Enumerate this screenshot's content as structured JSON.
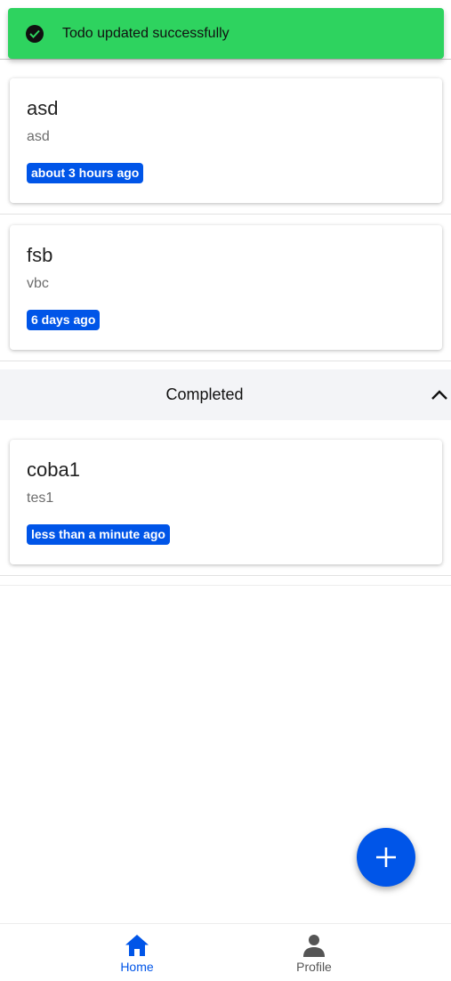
{
  "toast": {
    "message": "Todo updated successfully",
    "icon": "check-circle-icon",
    "color": "#2ed35f"
  },
  "todos": [
    {
      "title": "asd",
      "description": "asd",
      "time": "about 3 hours ago"
    },
    {
      "title": "fsb",
      "description": "vbc",
      "time": "6 days ago"
    }
  ],
  "completed": {
    "label": "Completed",
    "icon": "chevron-up-icon",
    "items": [
      {
        "title": "coba1",
        "description": "tes1",
        "time": "less than a minute ago"
      }
    ]
  },
  "fab": {
    "icon": "plus-icon"
  },
  "bottom_nav": {
    "items": [
      {
        "label": "Home",
        "icon": "home-icon",
        "active": true
      },
      {
        "label": "Profile",
        "icon": "person-icon",
        "active": false
      }
    ]
  },
  "colors": {
    "primary": "#0055e8",
    "toast": "#2ed35f",
    "section_bg": "#f3f4f7",
    "inactive": "#555555"
  }
}
